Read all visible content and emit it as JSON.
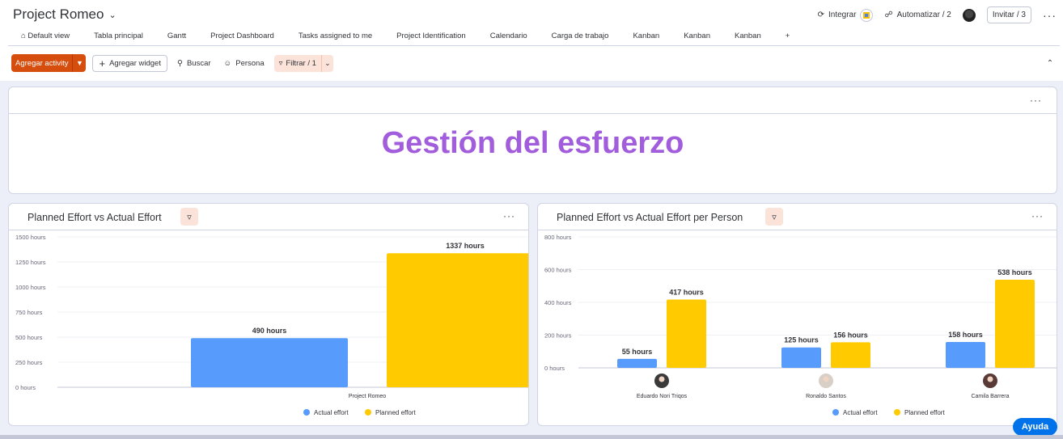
{
  "board": {
    "title": "Project Romeo"
  },
  "actions": {
    "integrate": "Integrar",
    "automate": "Automatizar / 2",
    "invite": "Invitar / 3"
  },
  "tabs": [
    "Default view",
    "Tabla principal",
    "Gantt",
    "Project Dashboard",
    "Tasks assigned to me",
    "Project Identification",
    "Calendario",
    "Carga de trabajo",
    "Kanban",
    "Kanban",
    "Kanban",
    "+"
  ],
  "toolbar": {
    "add_activity": "Agregar activity",
    "add_widget": "Agregar widget",
    "search": "Buscar",
    "person": "Persona",
    "filter": "Filtrar / 1"
  },
  "banner": {
    "title": "Gestión del esfuerzo",
    "color": "#a25ddc"
  },
  "widgets": {
    "left_title": "Planned Effort vs Actual Effort",
    "right_title": "Planned Effort vs Actual Effort per Person"
  },
  "help": "Ayuda",
  "chart_data": [
    {
      "type": "bar",
      "title": "Planned Effort vs Actual Effort",
      "categories": [
        "Project Romeo"
      ],
      "series": [
        {
          "name": "Actual effort",
          "color": "#579bfc",
          "values": [
            490
          ],
          "labels": [
            "490 hours"
          ]
        },
        {
          "name": "Planned effort",
          "color": "#ffcb00",
          "values": [
            1337
          ],
          "labels": [
            "1337 hours"
          ]
        }
      ],
      "yticks": [
        "0 hours",
        "250 hours",
        "500 hours",
        "750 hours",
        "1000 hours",
        "1250 hours",
        "1500 hours"
      ],
      "ylim": [
        0,
        1500
      ],
      "legend": "bottom"
    },
    {
      "type": "bar",
      "title": "Planned Effort vs Actual Effort per Person",
      "categories": [
        "Eduardo Nori Triqos",
        "Ronaldo Santos",
        "Camila Barrera"
      ],
      "series": [
        {
          "name": "Actual effort",
          "color": "#579bfc",
          "values": [
            55,
            125,
            158
          ],
          "labels": [
            "55 hours",
            "125 hours",
            "158 hours"
          ]
        },
        {
          "name": "Planned effort",
          "color": "#ffcb00",
          "values": [
            417,
            156,
            538
          ],
          "labels": [
            "417 hours",
            "156 hours",
            "538 hours"
          ]
        }
      ],
      "yticks": [
        "0 hours",
        "200 hours",
        "400 hours",
        "600 hours",
        "800 hours"
      ],
      "ylim": [
        0,
        800
      ],
      "legend": "bottom"
    }
  ]
}
